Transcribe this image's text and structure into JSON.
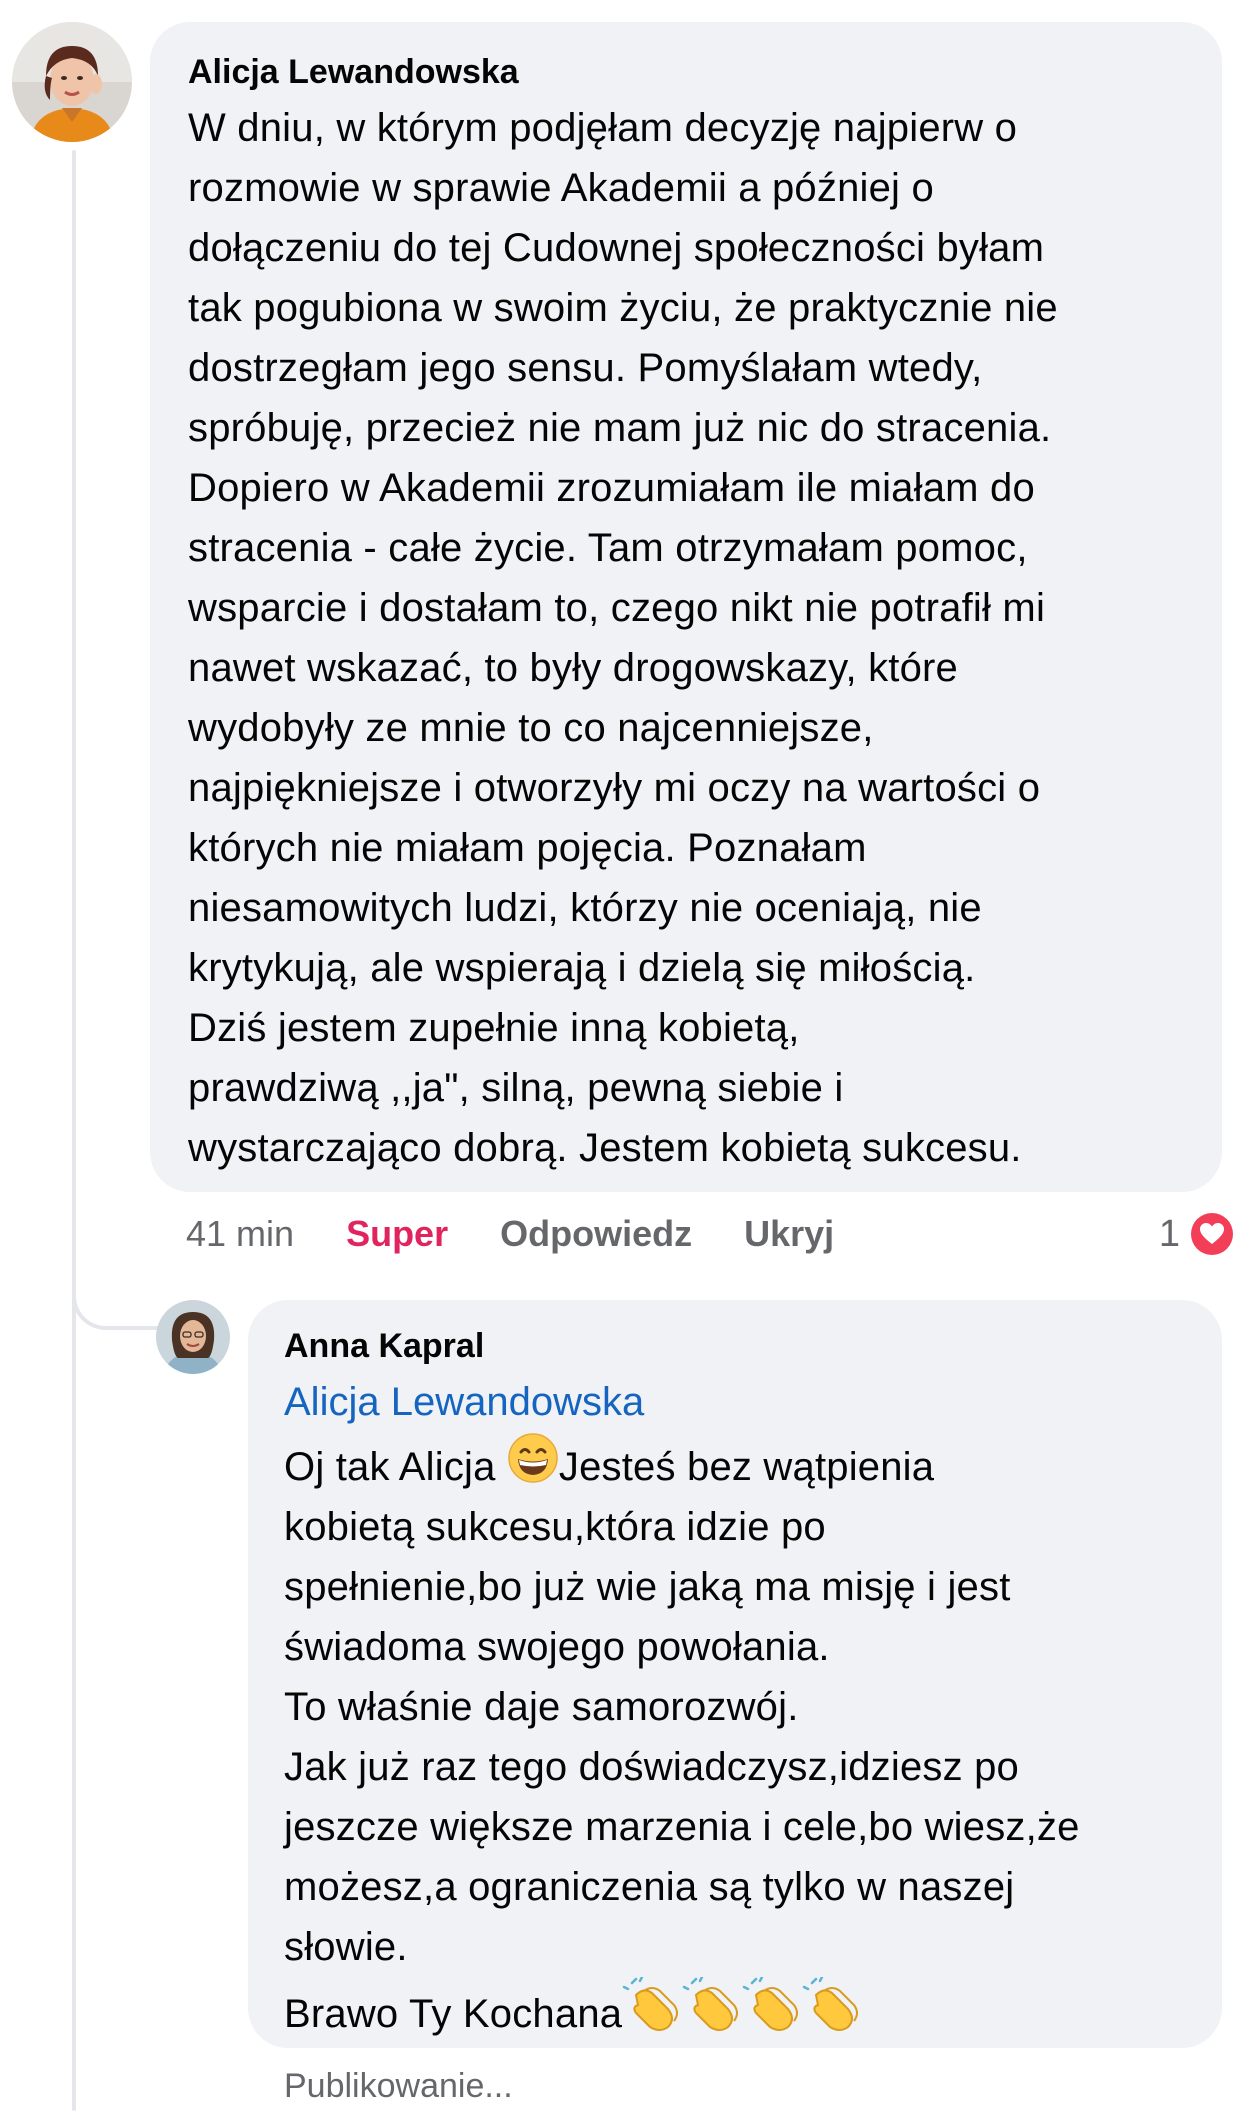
{
  "comment": {
    "author": "Alicja Lewandowska",
    "text": "W dniu, w którym podjęłam decyzję najpierw o\nrozmowie w sprawie Akademii a później o\ndołączeniu do tej Cudownej społeczności byłam\ntak pogubiona w swoim życiu, że praktycznie nie\ndostrzegłam jego sensu. Pomyślałam wtedy,\nspróbuję, przecież nie mam już nic do stracenia.\nDopiero w Akademii zrozumiałam ile miałam do\nstracenia - całe życie. Tam otrzymałam pomoc,\nwsparcie i dostałam to, czego nikt nie potrafił mi\nnawet wskazać, to były drogowskazy, które\nwydobyły ze mnie to co najcenniejsze,\nnajpiękniejsze i otworzyły mi oczy na wartości o\nktórych nie miałam pojęcia. Poznałam\nniesamowitych ludzi, którzy nie oceniają, nie\nkrytykują, ale wspierają i dzielą się miłością.\nDziś jestem zupełnie inną kobietą,\nprawdziwą ,,ja\", silną, pewną siebie i\nwystarczająco dobrą. Jestem kobietą sukcesu.",
    "time": "41 min",
    "actions": {
      "reaction_label": "Super",
      "reply_label": "Odpowiedz",
      "hide_label": "Ukryj"
    },
    "reaction_count": "1",
    "reaction_icon": "heart-icon",
    "reaction_color": "#f33e58",
    "reaction_label_color": "#e0245e"
  },
  "reply": {
    "author": "Anna Kapral",
    "mention": "Alicja Lewandowska",
    "mention_color": "#1565c0",
    "text_line_1a": "Oj tak Alicja ",
    "emoji": "grinning-face-icon",
    "text_line_1b": "Jesteś bez wątpienia",
    "text_rest": "kobietą sukcesu,która idzie po\nspełnienie,bo już wie jaką ma misję i jest\nświadoma swojego powołania.\nTo właśnie daje samorozwój.\nJak już raz tego doświadczysz,idziesz po\njeszcze większe marzenia i cele,bo wiesz,że\nmożesz,a ograniczenia są tylko w naszej\nsłowie.",
    "closing": "Brawo Ty Kochana",
    "closing_icons": [
      "clapping-hands-icon",
      "clapping-hands-icon",
      "clapping-hands-icon",
      "clapping-hands-icon"
    ],
    "status": "Publikowanie..."
  },
  "colors": {
    "bubble_background": "#f0f2f5",
    "secondary_text": "#65676b",
    "thread_line": "#e4e6eb"
  }
}
